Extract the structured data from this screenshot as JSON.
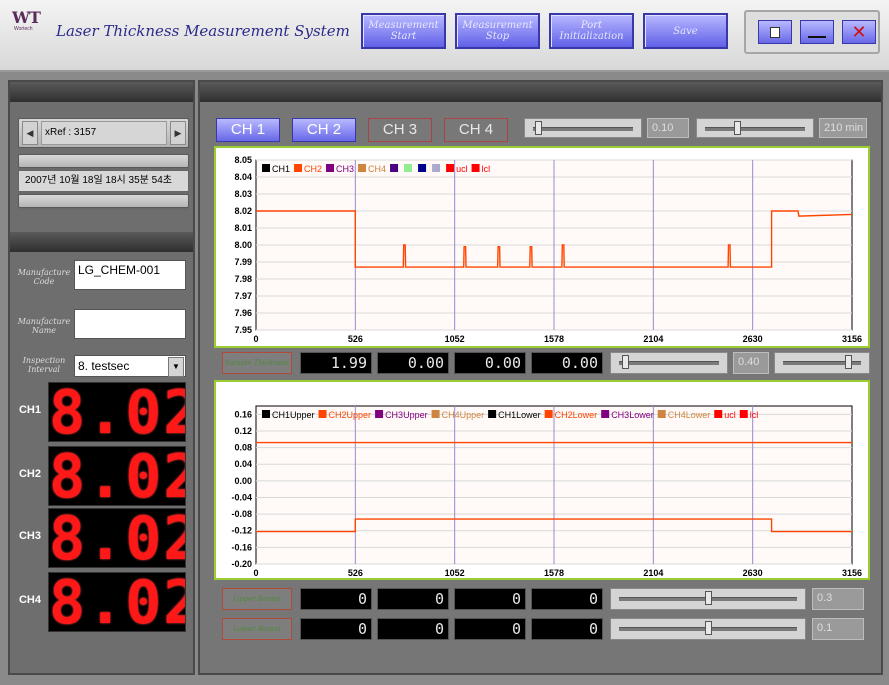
{
  "app": {
    "title": "Laser Thickness Measurement System",
    "logo_text": "WT",
    "logo_sub": "Wortech"
  },
  "toolbar": {
    "start_label": "Measurement Start",
    "stop_label": "Measurement Stop",
    "port_label": "Port Initialization",
    "save_label": "Save"
  },
  "left": {
    "xref": "xRef : 3157",
    "datetime": "2007년 10월 18일 18시 35분 54초",
    "manufacture_code_label": "Manufacture Code",
    "manufacture_code": "LG_CHEM-001",
    "manufacture_name_label": "Manufacture Name",
    "manufacture_name": "",
    "inspection_interval_label": "Inspection Interval",
    "inspection_interval": "8.  testsec",
    "channels": [
      {
        "label": "CH1",
        "value": "8.02"
      },
      {
        "label": "CH2",
        "value": "8.02"
      },
      {
        "label": "CH3",
        "value": "8.02"
      },
      {
        "label": "CH4",
        "value": "8.02"
      }
    ]
  },
  "tabs": [
    {
      "label": "CH 1",
      "active": true
    },
    {
      "label": "CH 2",
      "active": true
    },
    {
      "label": "CH 3",
      "active": false
    },
    {
      "label": "CH 4",
      "active": false
    }
  ],
  "top_controls": {
    "slider1_value": "0.10",
    "slider2_value": "210 min",
    "slider1_pos": 0.02,
    "slider2_pos": 0.3
  },
  "mid_controls": {
    "label": "Sample Thickness",
    "readouts": [
      "1.99",
      "0.00",
      "0.00",
      "0.00"
    ],
    "slider_value": "0.40",
    "slider1_pos": 0.03,
    "slider2_pos": 0.85
  },
  "bottom_controls": [
    {
      "label": "Upper Bound",
      "readouts": [
        "0",
        "0",
        "0",
        "0"
      ],
      "slider_value": "0.3",
      "slider_pos": 0.5
    },
    {
      "label": "Lower Bound",
      "readouts": [
        "0",
        "0",
        "0",
        "0"
      ],
      "slider_value": "0.1",
      "slider_pos": 0.5
    }
  ],
  "colors": {
    "ch1": "#000000",
    "ch2": "#ff4500",
    "ch3": "#800080",
    "ch4": "#cd853f",
    "ucl": "#ff0000",
    "lcl": "#ff0000",
    "extra1": "#4b0082",
    "extra2": "#90ee90",
    "extra3": "#00008b",
    "extra4": "#aaaacc"
  },
  "chart_data": [
    {
      "type": "line",
      "title": "",
      "xlabel": "",
      "ylabel": "",
      "xlim": [
        0,
        3156
      ],
      "ylim": [
        7.95,
        8.05
      ],
      "x_ticks": [
        0,
        526,
        1052,
        1578,
        2104,
        2630,
        3156
      ],
      "y_ticks": [
        7.95,
        7.96,
        7.97,
        7.98,
        7.99,
        8.0,
        8.01,
        8.02,
        8.03,
        8.04,
        8.05
      ],
      "y_tick_labels": [
        "7.95",
        "7.96",
        "7.97",
        "7.98",
        "7.99",
        "8.00",
        "8.01",
        "8.02",
        "8.03",
        "8.04",
        "8.05"
      ],
      "grid": true,
      "legend_position": "top-left",
      "legend": [
        {
          "name": "CH1",
          "color": "#000000"
        },
        {
          "name": "CH2",
          "color": "#ff4500"
        },
        {
          "name": "CH3",
          "color": "#800080"
        },
        {
          "name": "CH4",
          "color": "#cd853f"
        },
        {
          "name": "",
          "color": "#4b0082"
        },
        {
          "name": "",
          "color": "#90ee90"
        },
        {
          "name": "",
          "color": "#00008b"
        },
        {
          "name": "",
          "color": "#aaaacc"
        },
        {
          "name": "ucl",
          "color": "#ff0000"
        },
        {
          "name": "lcl",
          "color": "#ff0000"
        }
      ],
      "series": [
        {
          "name": "CH2",
          "color": "#ff4500",
          "x": [
            0,
            520,
            526,
            526,
            780,
            782,
            790,
            792,
            1100,
            1102,
            1110,
            1112,
            1280,
            1282,
            1290,
            1292,
            1450,
            1452,
            1460,
            1462,
            1620,
            1622,
            1630,
            1632,
            2500,
            2502,
            2510,
            2512,
            2730,
            2730,
            2870,
            2875,
            3156
          ],
          "y": [
            8.02,
            8.02,
            8.02,
            7.987,
            7.987,
            8.0,
            8.0,
            7.987,
            7.987,
            7.999,
            7.999,
            7.987,
            7.987,
            7.999,
            7.999,
            7.987,
            7.987,
            7.999,
            7.999,
            7.987,
            7.987,
            8.0,
            8.0,
            7.987,
            7.987,
            8.0,
            8.0,
            7.987,
            7.987,
            8.02,
            8.02,
            8.017,
            8.018
          ]
        }
      ]
    },
    {
      "type": "line",
      "title": "",
      "xlabel": "",
      "ylabel": "",
      "xlim": [
        0,
        3156
      ],
      "ylim": [
        -0.2,
        0.18
      ],
      "x_ticks": [
        0,
        526,
        1052,
        1578,
        2104,
        2630,
        3156
      ],
      "y_ticks": [
        -0.2,
        -0.16,
        -0.12,
        -0.08,
        -0.04,
        0.0,
        0.04,
        0.08,
        0.12,
        0.16
      ],
      "y_tick_labels": [
        "-0.20",
        "-0.16",
        "-0.12",
        "-0.08",
        "-0.04",
        "0.00",
        "0.04",
        "0.08",
        "0.12",
        "0.16"
      ],
      "grid": true,
      "legend_position": "top",
      "legend": [
        {
          "name": "CH1Upper",
          "color": "#000000"
        },
        {
          "name": "CH2Upper",
          "color": "#ff4500"
        },
        {
          "name": "CH3Upper",
          "color": "#800080"
        },
        {
          "name": "CH4Upper",
          "color": "#cd853f"
        },
        {
          "name": "CH1Lower",
          "color": "#000000"
        },
        {
          "name": "CH2Lower",
          "color": "#ff4500"
        },
        {
          "name": "CH3Lower",
          "color": "#800080"
        },
        {
          "name": "CH4Lower",
          "color": "#cd853f"
        },
        {
          "name": "ucl",
          "color": "#ff0000"
        },
        {
          "name": "lcl",
          "color": "#ff0000"
        }
      ],
      "series": [
        {
          "name": "CH2Upper",
          "color": "#ff4500",
          "x": [
            0,
            3156
          ],
          "y": [
            0.092,
            0.092
          ]
        },
        {
          "name": "CH2Lower",
          "color": "#ff4500",
          "x": [
            0,
            526,
            526,
            2730,
            2730,
            3156
          ],
          "y": [
            -0.122,
            -0.122,
            -0.092,
            -0.092,
            -0.122,
            -0.122
          ]
        }
      ]
    }
  ]
}
